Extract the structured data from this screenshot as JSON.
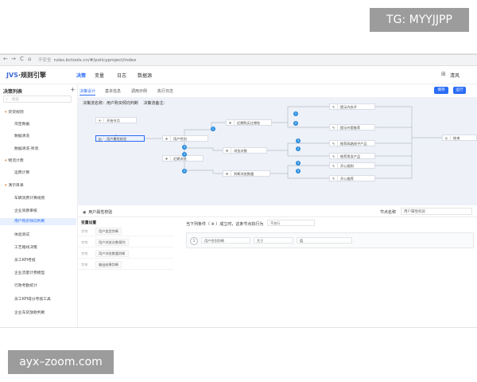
{
  "watermarks": {
    "top": "TG: MYYJJPP",
    "bottom": "ayx–zoom.com"
  },
  "browser": {
    "back": "←",
    "forward": "→",
    "reload": "C",
    "home": "⌂",
    "security": "不安全",
    "url": "rules.bctools.cn/#/policyproject/index"
  },
  "header": {
    "logo_mark": "JVS",
    "logo_text": "·规则引擎",
    "nav": [
      "决策",
      "变量",
      "日志",
      "数据源"
    ],
    "user": "清风",
    "grid_icon": "⊞"
  },
  "sidebar": {
    "title": "决策列表",
    "add": "+",
    "search_placeholder": "搜索",
    "items": [
      "贷贷规则",
      "淘宝数据",
      "数据清洗",
      "数据清洗-封装",
      "物流计费",
      "运费计算",
      "演示目录",
      "车辆消费计算规则",
      "企业资质审核",
      "用户购买倾向判断",
      "体验测试",
      "工艺路线决策",
      "员工KPI考核",
      "企业流量计费模型",
      "行政考勤统计",
      "员工KPI得分考核工具",
      "企业车贷放款判断"
    ]
  },
  "main": {
    "tabs": [
      "决策设计",
      "基本信息",
      "调用示例",
      "执行日志"
    ],
    "save_label": "保存",
    "run_label": "运行",
    "flow_name_label": "决策流名称：用户购买倾向判断",
    "flow_remark_label": "决策流备注："
  },
  "flow": {
    "nodes": {
      "start": "开始节点",
      "attr_check": "用户属性校验",
      "user_gender": "用户性别",
      "recent_buy": "近期购买过哪些",
      "recent_browse": "近期浏览",
      "browse_count": "浏览次数",
      "judge_browse": "判断浏览数量",
      "r1": "提示内衣子",
      "r2": "提示外套推荐",
      "r3": "推荐高路线子产品",
      "r4": "推荐男女产品",
      "r5": "开心规则",
      "r6": "开心推荐",
      "end": "结束"
    },
    "badges": [
      "1",
      "1",
      "2",
      "3",
      "2",
      "3",
      "2",
      "3",
      "3",
      "2"
    ]
  },
  "panel": {
    "title": "用户属性校验",
    "node_name_label": "节点名称",
    "node_name_value": "用户属性校验",
    "vars_title": "变量设置",
    "vars": [
      {
        "type": "字符",
        "name": "用户类型判断"
      },
      {
        "type": "字符",
        "name": "用户浏览次数预判"
      },
      {
        "type": "字符",
        "name": "用户浏览数量判断"
      },
      {
        "type": "字符",
        "name": "输出结果判断"
      }
    ],
    "rule_line": "当下列条件（ ※ ）成立时，这条节点执行为",
    "rule_select": "不执行",
    "cond_index": "1",
    "cond_field": "用户性别判断",
    "cond_op": "大于",
    "cond_value": "值"
  }
}
